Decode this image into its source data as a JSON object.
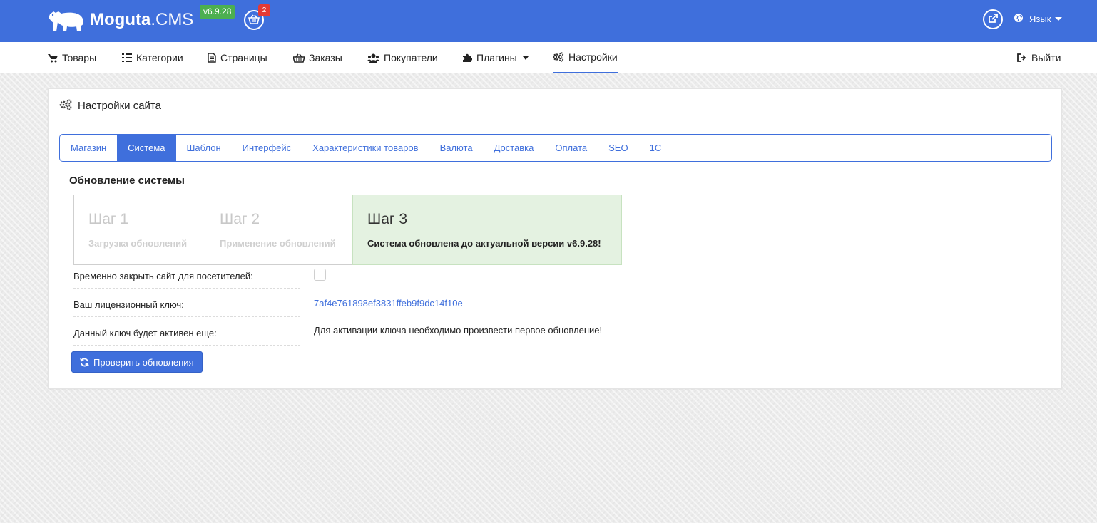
{
  "brand": {
    "name_bold": "Moguta",
    "name_thin": ".CMS",
    "version_badge": "v6.9.28"
  },
  "cart": {
    "count": "2"
  },
  "language": {
    "label": "Язык"
  },
  "nav": {
    "items": [
      {
        "label": "Товары",
        "icon": "cart-icon"
      },
      {
        "label": "Категории",
        "icon": "list-icon"
      },
      {
        "label": "Страницы",
        "icon": "file-icon"
      },
      {
        "label": "Заказы",
        "icon": "basket-icon"
      },
      {
        "label": "Покупатели",
        "icon": "users-icon"
      },
      {
        "label": "Плагины",
        "icon": "puzzle-icon"
      },
      {
        "label": "Настройки",
        "icon": "gears-icon"
      }
    ],
    "logout": "Выйти"
  },
  "panel": {
    "title": "Настройки сайта"
  },
  "tabs": [
    "Магазин",
    "Система",
    "Шаблон",
    "Интерфейс",
    "Характеристики товаров",
    "Валюта",
    "Доставка",
    "Оплата",
    "SEO",
    "1С"
  ],
  "active_tab": "Система",
  "update": {
    "section_title": "Обновление системы",
    "steps": [
      {
        "title": "Шаг 1",
        "desc": "Загрузка обновлений",
        "state": "inactive"
      },
      {
        "title": "Шаг 2",
        "desc": "Применение обновлений",
        "state": "inactive"
      },
      {
        "title": "Шаг 3",
        "desc": "Система обновлена до актуальной версии v6.9.28!",
        "state": "done"
      }
    ]
  },
  "form": {
    "close_site_label": "Временно закрыть сайт для посетителей:",
    "close_site_checked": false,
    "license_label": "Ваш лицензионный ключ:",
    "license_key": "7af4e761898ef3831ffeb9f9dc14f10e",
    "key_active_label": "Данный ключ будет активен еще:",
    "activation_note": "Для активации ключа необходимо произвести первое обновление!"
  },
  "check_button": {
    "label": "Проверить обновления"
  },
  "colors": {
    "primary": "#3f6fdc",
    "success_bg": "#e4f2e1",
    "badge_green": "#4caf50",
    "badge_red": "#e53935"
  }
}
